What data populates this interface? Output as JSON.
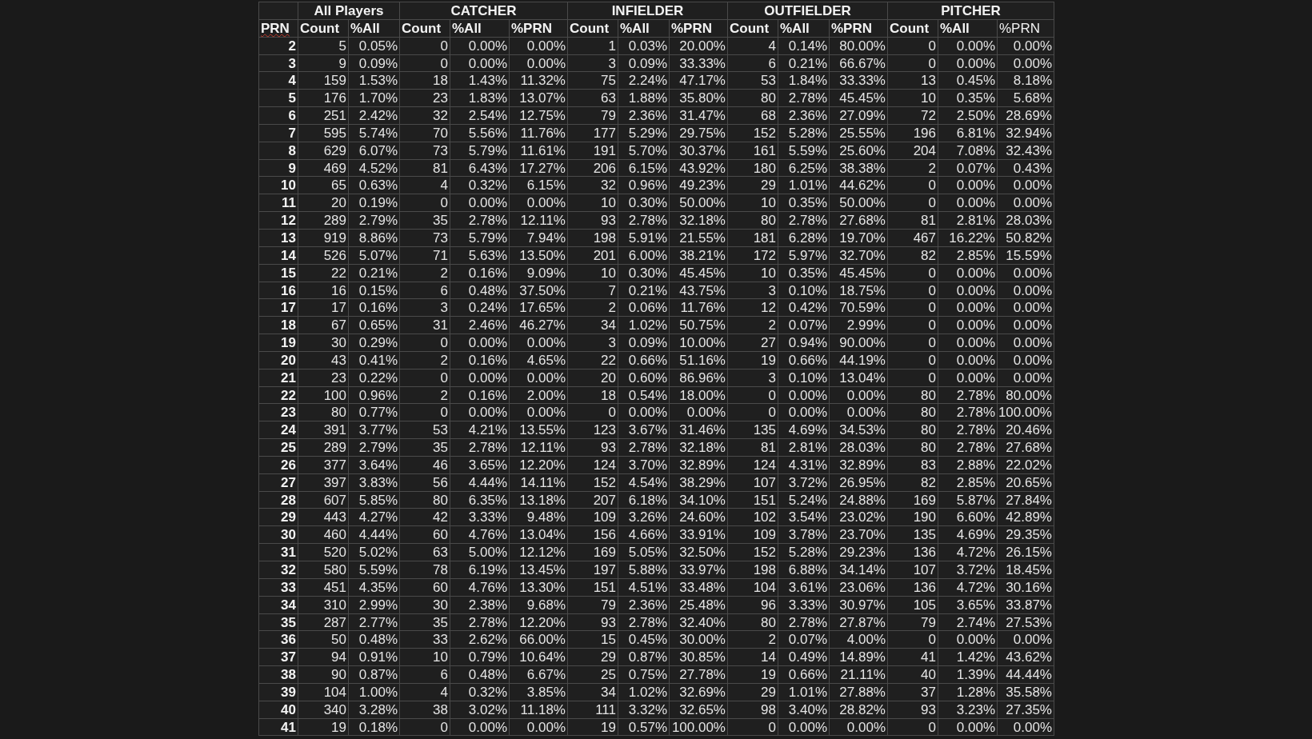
{
  "table": {
    "corner_label": "PRN",
    "groups": [
      {
        "label": "All Players",
        "columns": [
          {
            "label": "Count",
            "bold": true
          },
          {
            "label": "%All",
            "bold": true
          }
        ]
      },
      {
        "label": "CATCHER",
        "columns": [
          {
            "label": "Count",
            "bold": true
          },
          {
            "label": "%All",
            "bold": true
          },
          {
            "label": "%PRN",
            "bold": true
          }
        ]
      },
      {
        "label": "INFIELDER",
        "columns": [
          {
            "label": "Count",
            "bold": true
          },
          {
            "label": "%All",
            "bold": true
          },
          {
            "label": "%PRN",
            "bold": true
          }
        ]
      },
      {
        "label": "OUTFIELDER",
        "columns": [
          {
            "label": "Count",
            "bold": true
          },
          {
            "label": "%All",
            "bold": true
          },
          {
            "label": "%PRN",
            "bold": true
          }
        ]
      },
      {
        "label": "PITCHER",
        "columns": [
          {
            "label": "Count",
            "bold": true
          },
          {
            "label": "%All",
            "bold": true
          },
          {
            "label": "%PRN",
            "bold": false
          }
        ]
      }
    ],
    "rows": [
      {
        "prn": "2",
        "cells": [
          "5",
          "0.05%",
          "0",
          "0.00%",
          "0.00%",
          "1",
          "0.03%",
          "20.00%",
          "4",
          "0.14%",
          "80.00%",
          "0",
          "0.00%",
          "0.00%"
        ]
      },
      {
        "prn": "3",
        "cells": [
          "9",
          "0.09%",
          "0",
          "0.00%",
          "0.00%",
          "3",
          "0.09%",
          "33.33%",
          "6",
          "0.21%",
          "66.67%",
          "0",
          "0.00%",
          "0.00%"
        ]
      },
      {
        "prn": "4",
        "cells": [
          "159",
          "1.53%",
          "18",
          "1.43%",
          "11.32%",
          "75",
          "2.24%",
          "47.17%",
          "53",
          "1.84%",
          "33.33%",
          "13",
          "0.45%",
          "8.18%"
        ]
      },
      {
        "prn": "5",
        "cells": [
          "176",
          "1.70%",
          "23",
          "1.83%",
          "13.07%",
          "63",
          "1.88%",
          "35.80%",
          "80",
          "2.78%",
          "45.45%",
          "10",
          "0.35%",
          "5.68%"
        ]
      },
      {
        "prn": "6",
        "cells": [
          "251",
          "2.42%",
          "32",
          "2.54%",
          "12.75%",
          "79",
          "2.36%",
          "31.47%",
          "68",
          "2.36%",
          "27.09%",
          "72",
          "2.50%",
          "28.69%"
        ]
      },
      {
        "prn": "7",
        "cells": [
          "595",
          "5.74%",
          "70",
          "5.56%",
          "11.76%",
          "177",
          "5.29%",
          "29.75%",
          "152",
          "5.28%",
          "25.55%",
          "196",
          "6.81%",
          "32.94%"
        ]
      },
      {
        "prn": "8",
        "cells": [
          "629",
          "6.07%",
          "73",
          "5.79%",
          "11.61%",
          "191",
          "5.70%",
          "30.37%",
          "161",
          "5.59%",
          "25.60%",
          "204",
          "7.08%",
          "32.43%"
        ]
      },
      {
        "prn": "9",
        "cells": [
          "469",
          "4.52%",
          "81",
          "6.43%",
          "17.27%",
          "206",
          "6.15%",
          "43.92%",
          "180",
          "6.25%",
          "38.38%",
          "2",
          "0.07%",
          "0.43%"
        ]
      },
      {
        "prn": "10",
        "cells": [
          "65",
          "0.63%",
          "4",
          "0.32%",
          "6.15%",
          "32",
          "0.96%",
          "49.23%",
          "29",
          "1.01%",
          "44.62%",
          "0",
          "0.00%",
          "0.00%"
        ]
      },
      {
        "prn": "11",
        "cells": [
          "20",
          "0.19%",
          "0",
          "0.00%",
          "0.00%",
          "10",
          "0.30%",
          "50.00%",
          "10",
          "0.35%",
          "50.00%",
          "0",
          "0.00%",
          "0.00%"
        ]
      },
      {
        "prn": "12",
        "cells": [
          "289",
          "2.79%",
          "35",
          "2.78%",
          "12.11%",
          "93",
          "2.78%",
          "32.18%",
          "80",
          "2.78%",
          "27.68%",
          "81",
          "2.81%",
          "28.03%"
        ]
      },
      {
        "prn": "13",
        "cells": [
          "919",
          "8.86%",
          "73",
          "5.79%",
          "7.94%",
          "198",
          "5.91%",
          "21.55%",
          "181",
          "6.28%",
          "19.70%",
          "467",
          "16.22%",
          "50.82%"
        ]
      },
      {
        "prn": "14",
        "cells": [
          "526",
          "5.07%",
          "71",
          "5.63%",
          "13.50%",
          "201",
          "6.00%",
          "38.21%",
          "172",
          "5.97%",
          "32.70%",
          "82",
          "2.85%",
          "15.59%"
        ]
      },
      {
        "prn": "15",
        "cells": [
          "22",
          "0.21%",
          "2",
          "0.16%",
          "9.09%",
          "10",
          "0.30%",
          "45.45%",
          "10",
          "0.35%",
          "45.45%",
          "0",
          "0.00%",
          "0.00%"
        ]
      },
      {
        "prn": "16",
        "cells": [
          "16",
          "0.15%",
          "6",
          "0.48%",
          "37.50%",
          "7",
          "0.21%",
          "43.75%",
          "3",
          "0.10%",
          "18.75%",
          "0",
          "0.00%",
          "0.00%"
        ]
      },
      {
        "prn": "17",
        "cells": [
          "17",
          "0.16%",
          "3",
          "0.24%",
          "17.65%",
          "2",
          "0.06%",
          "11.76%",
          "12",
          "0.42%",
          "70.59%",
          "0",
          "0.00%",
          "0.00%"
        ]
      },
      {
        "prn": "18",
        "cells": [
          "67",
          "0.65%",
          "31",
          "2.46%",
          "46.27%",
          "34",
          "1.02%",
          "50.75%",
          "2",
          "0.07%",
          "2.99%",
          "0",
          "0.00%",
          "0.00%"
        ]
      },
      {
        "prn": "19",
        "cells": [
          "30",
          "0.29%",
          "0",
          "0.00%",
          "0.00%",
          "3",
          "0.09%",
          "10.00%",
          "27",
          "0.94%",
          "90.00%",
          "0",
          "0.00%",
          "0.00%"
        ]
      },
      {
        "prn": "20",
        "cells": [
          "43",
          "0.41%",
          "2",
          "0.16%",
          "4.65%",
          "22",
          "0.66%",
          "51.16%",
          "19",
          "0.66%",
          "44.19%",
          "0",
          "0.00%",
          "0.00%"
        ]
      },
      {
        "prn": "21",
        "cells": [
          "23",
          "0.22%",
          "0",
          "0.00%",
          "0.00%",
          "20",
          "0.60%",
          "86.96%",
          "3",
          "0.10%",
          "13.04%",
          "0",
          "0.00%",
          "0.00%"
        ]
      },
      {
        "prn": "22",
        "cells": [
          "100",
          "0.96%",
          "2",
          "0.16%",
          "2.00%",
          "18",
          "0.54%",
          "18.00%",
          "0",
          "0.00%",
          "0.00%",
          "80",
          "2.78%",
          "80.00%"
        ]
      },
      {
        "prn": "23",
        "cells": [
          "80",
          "0.77%",
          "0",
          "0.00%",
          "0.00%",
          "0",
          "0.00%",
          "0.00%",
          "0",
          "0.00%",
          "0.00%",
          "80",
          "2.78%",
          "100.00%"
        ]
      },
      {
        "prn": "24",
        "cells": [
          "391",
          "3.77%",
          "53",
          "4.21%",
          "13.55%",
          "123",
          "3.67%",
          "31.46%",
          "135",
          "4.69%",
          "34.53%",
          "80",
          "2.78%",
          "20.46%"
        ]
      },
      {
        "prn": "25",
        "cells": [
          "289",
          "2.79%",
          "35",
          "2.78%",
          "12.11%",
          "93",
          "2.78%",
          "32.18%",
          "81",
          "2.81%",
          "28.03%",
          "80",
          "2.78%",
          "27.68%"
        ]
      },
      {
        "prn": "26",
        "cells": [
          "377",
          "3.64%",
          "46",
          "3.65%",
          "12.20%",
          "124",
          "3.70%",
          "32.89%",
          "124",
          "4.31%",
          "32.89%",
          "83",
          "2.88%",
          "22.02%"
        ]
      },
      {
        "prn": "27",
        "cells": [
          "397",
          "3.83%",
          "56",
          "4.44%",
          "14.11%",
          "152",
          "4.54%",
          "38.29%",
          "107",
          "3.72%",
          "26.95%",
          "82",
          "2.85%",
          "20.65%"
        ]
      },
      {
        "prn": "28",
        "cells": [
          "607",
          "5.85%",
          "80",
          "6.35%",
          "13.18%",
          "207",
          "6.18%",
          "34.10%",
          "151",
          "5.24%",
          "24.88%",
          "169",
          "5.87%",
          "27.84%"
        ]
      },
      {
        "prn": "29",
        "cells": [
          "443",
          "4.27%",
          "42",
          "3.33%",
          "9.48%",
          "109",
          "3.26%",
          "24.60%",
          "102",
          "3.54%",
          "23.02%",
          "190",
          "6.60%",
          "42.89%"
        ]
      },
      {
        "prn": "30",
        "cells": [
          "460",
          "4.44%",
          "60",
          "4.76%",
          "13.04%",
          "156",
          "4.66%",
          "33.91%",
          "109",
          "3.78%",
          "23.70%",
          "135",
          "4.69%",
          "29.35%"
        ]
      },
      {
        "prn": "31",
        "cells": [
          "520",
          "5.02%",
          "63",
          "5.00%",
          "12.12%",
          "169",
          "5.05%",
          "32.50%",
          "152",
          "5.28%",
          "29.23%",
          "136",
          "4.72%",
          "26.15%"
        ]
      },
      {
        "prn": "32",
        "cells": [
          "580",
          "5.59%",
          "78",
          "6.19%",
          "13.45%",
          "197",
          "5.88%",
          "33.97%",
          "198",
          "6.88%",
          "34.14%",
          "107",
          "3.72%",
          "18.45%"
        ]
      },
      {
        "prn": "33",
        "cells": [
          "451",
          "4.35%",
          "60",
          "4.76%",
          "13.30%",
          "151",
          "4.51%",
          "33.48%",
          "104",
          "3.61%",
          "23.06%",
          "136",
          "4.72%",
          "30.16%"
        ]
      },
      {
        "prn": "34",
        "cells": [
          "310",
          "2.99%",
          "30",
          "2.38%",
          "9.68%",
          "79",
          "2.36%",
          "25.48%",
          "96",
          "3.33%",
          "30.97%",
          "105",
          "3.65%",
          "33.87%"
        ]
      },
      {
        "prn": "35",
        "cells": [
          "287",
          "2.77%",
          "35",
          "2.78%",
          "12.20%",
          "93",
          "2.78%",
          "32.40%",
          "80",
          "2.78%",
          "27.87%",
          "79",
          "2.74%",
          "27.53%"
        ]
      },
      {
        "prn": "36",
        "cells": [
          "50",
          "0.48%",
          "33",
          "2.62%",
          "66.00%",
          "15",
          "0.45%",
          "30.00%",
          "2",
          "0.07%",
          "4.00%",
          "0",
          "0.00%",
          "0.00%"
        ]
      },
      {
        "prn": "37",
        "cells": [
          "94",
          "0.91%",
          "10",
          "0.79%",
          "10.64%",
          "29",
          "0.87%",
          "30.85%",
          "14",
          "0.49%",
          "14.89%",
          "41",
          "1.42%",
          "43.62%"
        ]
      },
      {
        "prn": "38",
        "cells": [
          "90",
          "0.87%",
          "6",
          "0.48%",
          "6.67%",
          "25",
          "0.75%",
          "27.78%",
          "19",
          "0.66%",
          "21.11%",
          "40",
          "1.39%",
          "44.44%"
        ]
      },
      {
        "prn": "39",
        "cells": [
          "104",
          "1.00%",
          "4",
          "0.32%",
          "3.85%",
          "34",
          "1.02%",
          "32.69%",
          "29",
          "1.01%",
          "27.88%",
          "37",
          "1.28%",
          "35.58%"
        ]
      },
      {
        "prn": "40",
        "cells": [
          "340",
          "3.28%",
          "38",
          "3.02%",
          "11.18%",
          "111",
          "3.32%",
          "32.65%",
          "98",
          "3.40%",
          "28.82%",
          "93",
          "3.23%",
          "27.35%"
        ]
      },
      {
        "prn": "41",
        "cells": [
          "19",
          "0.18%",
          "0",
          "0.00%",
          "0.00%",
          "19",
          "0.57%",
          "100.00%",
          "0",
          "0.00%",
          "0.00%",
          "0",
          "0.00%",
          "0.00%"
        ]
      }
    ]
  }
}
